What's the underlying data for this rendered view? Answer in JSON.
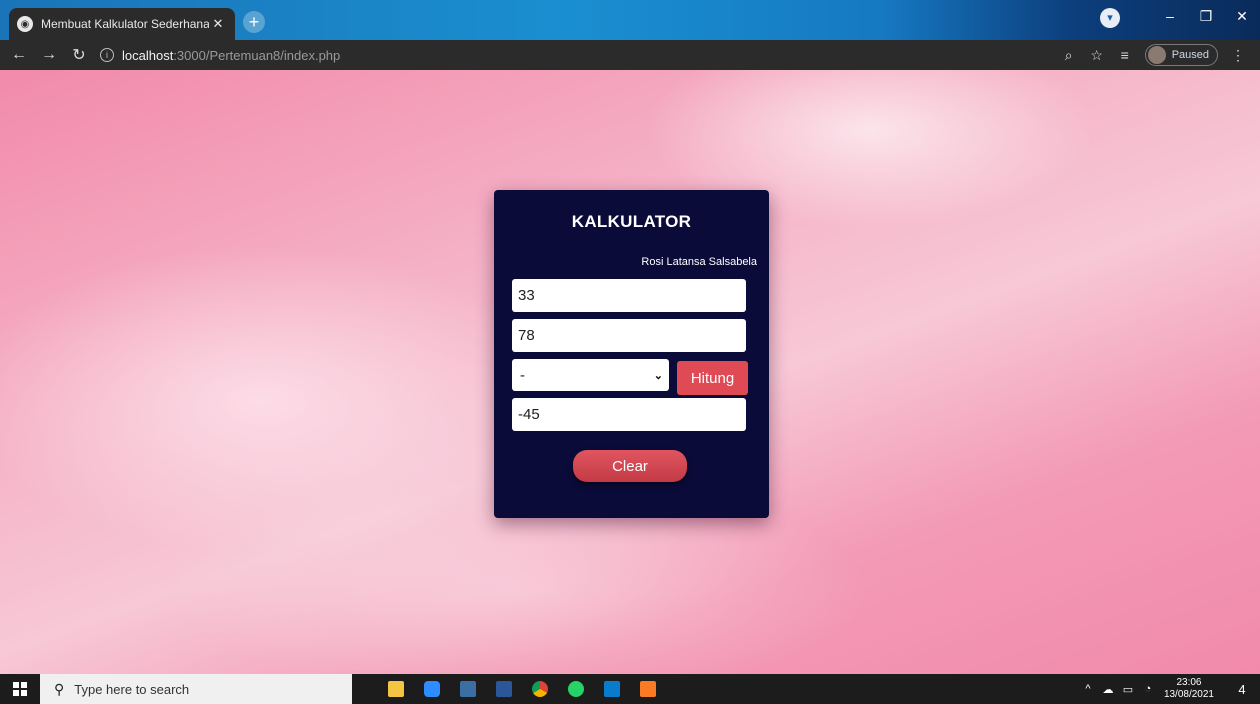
{
  "browser": {
    "tab_title": "Membuat Kalkulator Sederhana |",
    "tab_close_glyph": "✕",
    "new_tab_glyph": "+",
    "url_host": "localhost",
    "url_path": ":3000/Pertemuan8/index.php",
    "profile_status": "Paused",
    "icons": [
      "back-arrow-icon",
      "forward-arrow-icon",
      "reload-icon",
      "info-icon",
      "zoom-icon",
      "star-icon",
      "reading-list-icon",
      "menu-dots-icon"
    ]
  },
  "calculator": {
    "title": "KALKULATOR",
    "author": "Rosi Latansa Salsabela",
    "input_a": "33",
    "input_b": "78",
    "operator": "-",
    "hitung_label": "Hitung",
    "result": "-45",
    "clear_label": "Clear",
    "colors": {
      "card": "#0b0b3a",
      "button": "#e04a55"
    }
  },
  "taskbar": {
    "search_placeholder": "Type here to search",
    "time": "23:06",
    "date": "13/08/2021",
    "notification_count": "4",
    "apps": [
      "file-explorer-icon",
      "zoom-app-icon",
      "snipping-tool-icon",
      "word-icon",
      "chrome-icon",
      "whatsapp-icon",
      "vscode-icon",
      "xampp-icon"
    ]
  }
}
